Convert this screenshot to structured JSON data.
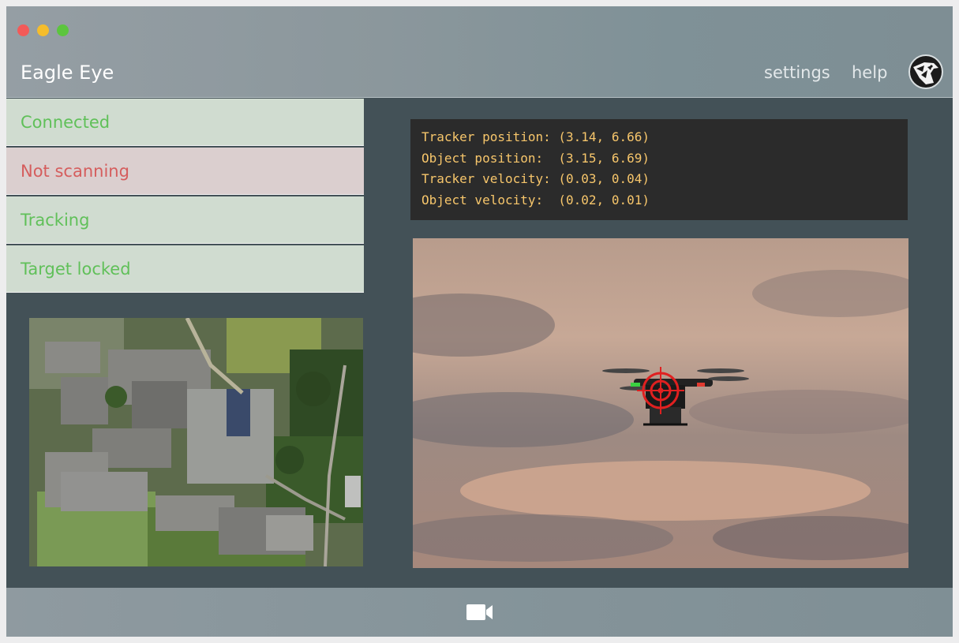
{
  "app": {
    "title": "Eagle Eye"
  },
  "nav": {
    "settings": "settings",
    "help": "help"
  },
  "user": {
    "avatar_icon": "eagle-logo-icon"
  },
  "status": {
    "connected": "Connected",
    "scanning": "Not scanning",
    "tracking": "Tracking",
    "target": "Target locked"
  },
  "telemetry": {
    "tracker_position": "Tracker position: (3.14, 6.66)",
    "object_position": "Object position:  (3.15, 6.69)",
    "tracker_velocity": "Tracker velocity: (0.03, 0.04)",
    "object_velocity": "Object velocity:  (0.02, 0.01)"
  },
  "colors": {
    "status_ok_bg": "#d0dcd0",
    "status_ok_text": "#60c059",
    "status_bad_bg": "#dbcfcf",
    "status_bad_text": "#d55d5d",
    "telemetry_text": "#f7c66b",
    "crosshair": "#e02020"
  },
  "icons": {
    "record": "video-camera-icon",
    "crosshair": "crosshair-icon"
  }
}
